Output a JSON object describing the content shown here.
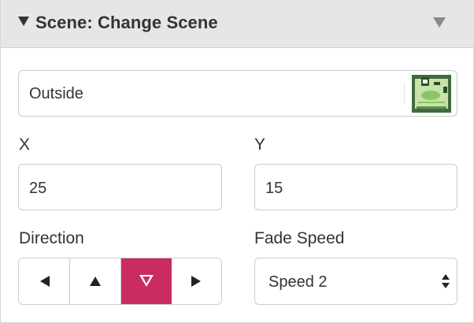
{
  "header": {
    "title": "Scene: Change Scene",
    "collapse_icon": "caret-down-icon",
    "menu_icon": "caret-down-icon"
  },
  "scene": {
    "value": "Outside",
    "thumbnail_icon": "scene-thumbnail-icon"
  },
  "x": {
    "label": "X",
    "value": "25"
  },
  "y": {
    "label": "Y",
    "value": "15"
  },
  "direction": {
    "label": "Direction",
    "options": [
      "left",
      "up",
      "down",
      "right"
    ],
    "selected": "down"
  },
  "fade_speed": {
    "label": "Fade Speed",
    "value": "Speed 2"
  },
  "colors": {
    "accent": "#c92c62",
    "header_bg": "#e6e6e6",
    "border": "#cccccc"
  }
}
